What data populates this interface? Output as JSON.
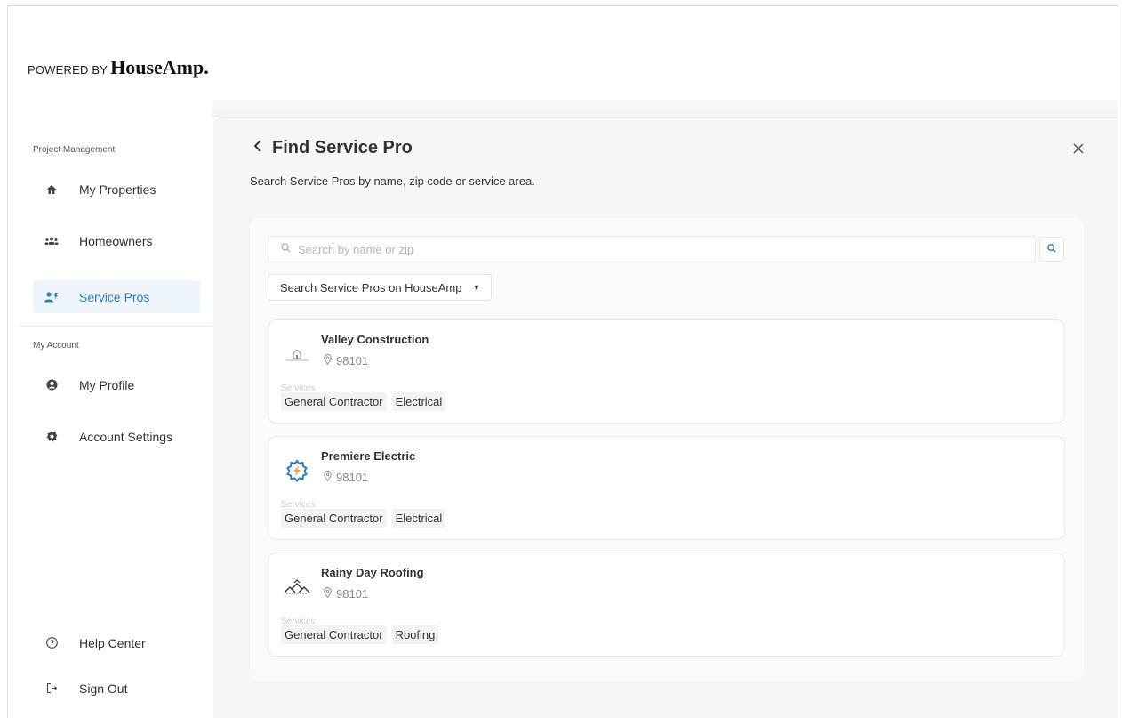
{
  "brand": {
    "powered_by": "POWERED BY",
    "name": "HouseAmp."
  },
  "sidebar": {
    "section_project": "Project Management",
    "section_account": "My Account",
    "items": [
      {
        "label": "My Properties",
        "icon": "home-icon"
      },
      {
        "label": "Homeowners",
        "icon": "group-icon"
      },
      {
        "label": "Service Pros",
        "icon": "service-pro-icon",
        "active": true
      },
      {
        "label": "My Profile",
        "icon": "user-circle-icon"
      },
      {
        "label": "Account Settings",
        "icon": "gear-icon"
      },
      {
        "label": "Help Center",
        "icon": "help-icon"
      },
      {
        "label": "Sign Out",
        "icon": "sign-out-icon"
      }
    ]
  },
  "header": {
    "title": "Find Service Pro",
    "subtitle": "Search Service Pros by name, zip code or service area."
  },
  "search": {
    "placeholder": "Search by name or zip",
    "value": "",
    "source_select": "Search Service Pros on HouseAmp"
  },
  "pros": [
    {
      "name": "Valley Construction",
      "zip": "98101",
      "services_label": "Services",
      "services": [
        "General Contractor",
        "Electrical"
      ],
      "logo": "house-outline-logo"
    },
    {
      "name": "Premiere Electric",
      "zip": "98101",
      "services_label": "Services",
      "services": [
        "General Contractor",
        "Electrical"
      ],
      "logo": "gear-bolt-logo"
    },
    {
      "name": "Rainy Day Roofing",
      "zip": "98101",
      "services_label": "Services",
      "services": [
        "General Contractor",
        "Roofing"
      ],
      "logo": "rooftops-logo"
    }
  ],
  "colors": {
    "accent": "#2b7ec2",
    "active_bg": "#eef5fb",
    "panel_bg": "#f6f6f6"
  }
}
